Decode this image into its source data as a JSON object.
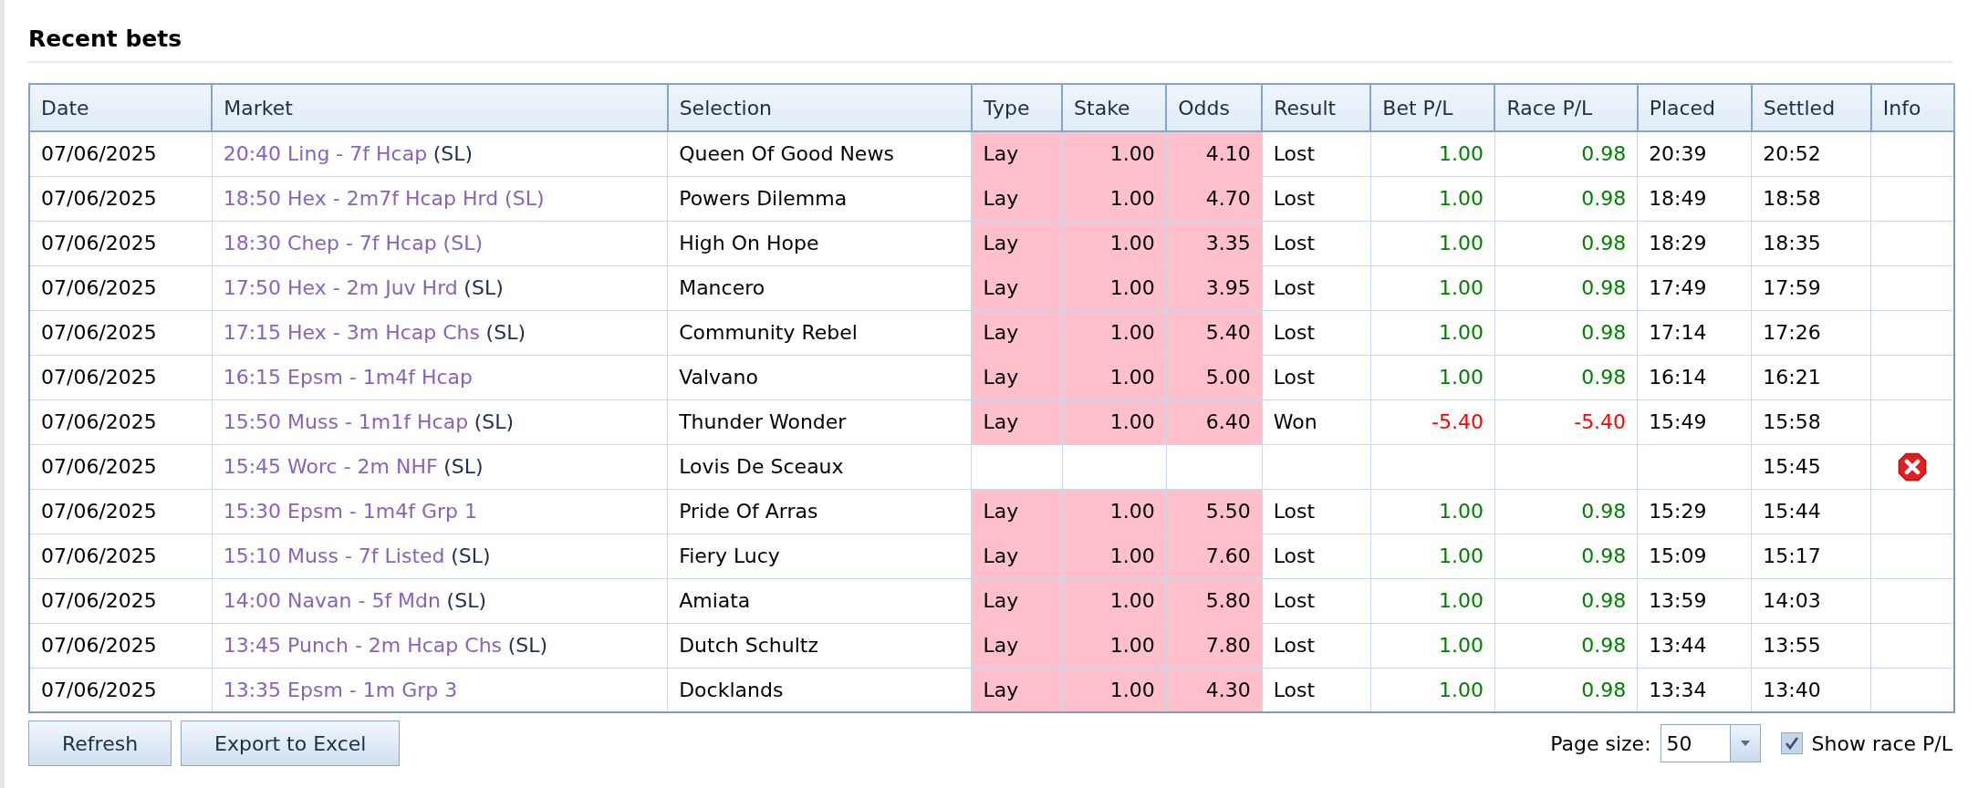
{
  "title": "Recent bets",
  "columns": [
    "Date",
    "Market",
    "Selection",
    "Type",
    "Stake",
    "Odds",
    "Result",
    "Bet P/L",
    "Race P/L",
    "Placed",
    "Settled",
    "Info"
  ],
  "rows": [
    {
      "date": "07/06/2025",
      "market": "20:40 Ling - 7f Hcap",
      "suffix": "(SL)",
      "selection": "Queen Of Good News",
      "highlight": true,
      "type": "Lay",
      "stake": "1.00",
      "odds": "4.10",
      "result": "Lost",
      "bet_pl": "1.00",
      "race_pl": "0.98",
      "loss": false,
      "placed": "20:39",
      "settled": "20:52",
      "error": false
    },
    {
      "date": "07/06/2025",
      "market": "18:50 Hex - 2m7f Hcap Hrd (SL)",
      "selection": "Powers Dilemma",
      "highlight": true,
      "type": "Lay",
      "stake": "1.00",
      "odds": "4.70",
      "result": "Lost",
      "bet_pl": "1.00",
      "race_pl": "0.98",
      "loss": false,
      "placed": "18:49",
      "settled": "18:58",
      "error": false
    },
    {
      "date": "07/06/2025",
      "market": "18:30 Chep - 7f Hcap (SL)",
      "selection": "High On Hope",
      "highlight": true,
      "type": "Lay",
      "stake": "1.00",
      "odds": "3.35",
      "result": "Lost",
      "bet_pl": "1.00",
      "race_pl": "0.98",
      "loss": false,
      "placed": "18:29",
      "settled": "18:35",
      "error": false
    },
    {
      "date": "07/06/2025",
      "market": "17:50 Hex - 2m Juv Hrd",
      "suffix": "(SL)",
      "selection": "Mancero",
      "highlight": true,
      "type": "Lay",
      "stake": "1.00",
      "odds": "3.95",
      "result": "Lost",
      "bet_pl": "1.00",
      "race_pl": "0.98",
      "loss": false,
      "placed": "17:49",
      "settled": "17:59",
      "error": false
    },
    {
      "date": "07/06/2025",
      "market": "17:15 Hex - 3m Hcap Chs",
      "suffix": "(SL)",
      "selection": "Community Rebel",
      "highlight": true,
      "type": "Lay",
      "stake": "1.00",
      "odds": "5.40",
      "result": "Lost",
      "bet_pl": "1.00",
      "race_pl": "0.98",
      "loss": false,
      "placed": "17:14",
      "settled": "17:26",
      "error": false
    },
    {
      "date": "07/06/2025",
      "market": "16:15 Epsm - 1m4f Hcap",
      "selection": "Valvano",
      "highlight": true,
      "type": "Lay",
      "stake": "1.00",
      "odds": "5.00",
      "result": "Lost",
      "bet_pl": "1.00",
      "race_pl": "0.98",
      "loss": false,
      "placed": "16:14",
      "settled": "16:21",
      "error": false
    },
    {
      "date": "07/06/2025",
      "market": "15:50 Muss - 1m1f Hcap",
      "suffix": "(SL)",
      "selection": "Thunder Wonder",
      "highlight": true,
      "type": "Lay",
      "stake": "1.00",
      "odds": "6.40",
      "result": "Won",
      "bet_pl": "-5.40",
      "race_pl": "-5.40",
      "loss": true,
      "placed": "15:49",
      "settled": "15:58",
      "error": false
    },
    {
      "date": "07/06/2025",
      "market": "15:45 Worc - 2m NHF",
      "suffix": "(SL)",
      "selection": "Lovis De Sceaux",
      "highlight": false,
      "settled": "15:45",
      "error": true
    },
    {
      "date": "07/06/2025",
      "market": "15:30 Epsm - 1m4f Grp 1",
      "selection": "Pride Of Arras",
      "highlight": true,
      "type": "Lay",
      "stake": "1.00",
      "odds": "5.50",
      "result": "Lost",
      "bet_pl": "1.00",
      "race_pl": "0.98",
      "loss": false,
      "placed": "15:29",
      "settled": "15:44",
      "error": false
    },
    {
      "date": "07/06/2025",
      "market": "15:10 Muss - 7f Listed",
      "suffix": "(SL)",
      "selection": "Fiery Lucy",
      "highlight": true,
      "type": "Lay",
      "stake": "1.00",
      "odds": "7.60",
      "result": "Lost",
      "bet_pl": "1.00",
      "race_pl": "0.98",
      "loss": false,
      "placed": "15:09",
      "settled": "15:17",
      "error": false
    },
    {
      "date": "07/06/2025",
      "market": "14:00 Navan - 5f Mdn",
      "suffix": "(SL)",
      "selection": "Amiata",
      "highlight": true,
      "type": "Lay",
      "stake": "1.00",
      "odds": "5.80",
      "result": "Lost",
      "bet_pl": "1.00",
      "race_pl": "0.98",
      "loss": false,
      "placed": "13:59",
      "settled": "14:03",
      "error": false
    },
    {
      "date": "07/06/2025",
      "market": "13:45 Punch - 2m Hcap Chs",
      "suffix": "(SL)",
      "selection": "Dutch Schultz",
      "highlight": true,
      "type": "Lay",
      "stake": "1.00",
      "odds": "7.80",
      "result": "Lost",
      "bet_pl": "1.00",
      "race_pl": "0.98",
      "loss": false,
      "placed": "13:44",
      "settled": "13:55",
      "error": false
    },
    {
      "date": "07/06/2025",
      "market": "13:35 Epsm - 1m Grp 3",
      "selection": "Docklands",
      "highlight": true,
      "type": "Lay",
      "stake": "1.00",
      "odds": "4.30",
      "result": "Lost",
      "bet_pl": "1.00",
      "race_pl": "0.98",
      "loss": false,
      "placed": "13:34",
      "settled": "13:40",
      "error": false
    }
  ],
  "buttons": [
    "Refresh",
    "Export to Excel"
  ],
  "page_size": {
    "label": "Page size:",
    "value": "50"
  },
  "show_race_pl": {
    "label": "Show race P/L",
    "checked": true
  }
}
